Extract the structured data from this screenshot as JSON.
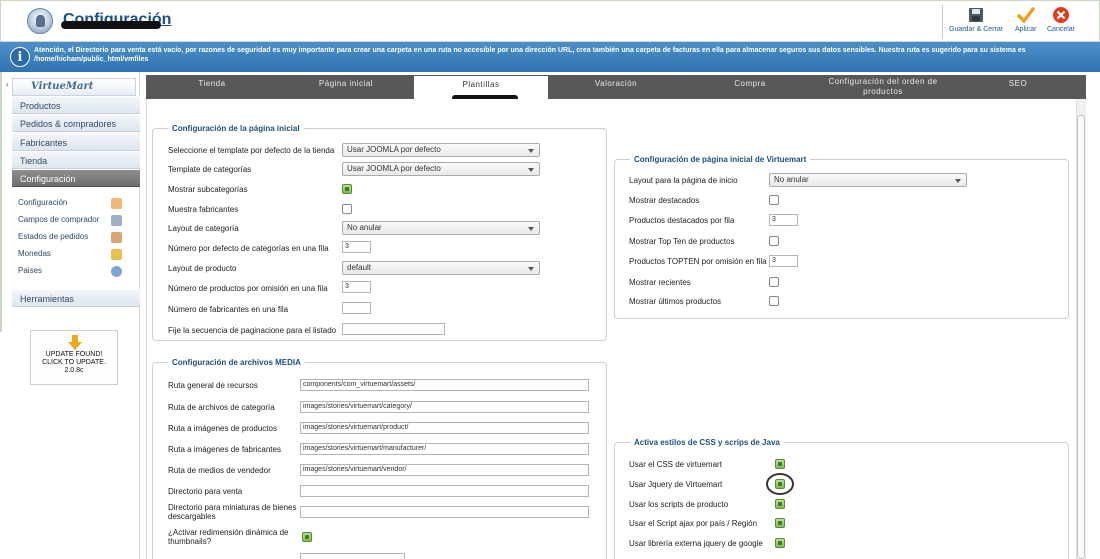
{
  "header": {
    "title": "Configuración",
    "buttons": [
      {
        "label": "Guardar & Cerrar",
        "icon": "save-icon"
      },
      {
        "label": "Aplicar",
        "icon": "checkmark-icon"
      },
      {
        "label": "Cancelar",
        "icon": "cancel-icon"
      }
    ]
  },
  "info_bar": {
    "message": "Atención, el Directorio para venta está vacío, por razones de seguridad es muy importante para crear una carpeta en una ruta no accesible por una dirección URL, crea también una carpeta de facturas en ella para almacenar seguros sus datos sensibles. Nuestra ruta es sugerido para su sistema es /home/hicham/public_html/vmfiles"
  },
  "sidebar": {
    "logo": "VirtueMart",
    "items": [
      {
        "label": "Productos"
      },
      {
        "label": "Pedidos & compradores"
      },
      {
        "label": "Fabricantes"
      },
      {
        "label": "Tienda"
      },
      {
        "label": "Configuración"
      }
    ],
    "sub_items": [
      {
        "label": "Configuración",
        "icon_color": "#e07a2a"
      },
      {
        "label": "Campos de comprador",
        "icon_color": "#7a8fa8"
      },
      {
        "label": "Estados de pedidos",
        "icon_color": "#c98a4a"
      },
      {
        "label": "Monedas",
        "icon_color": "#e0b040"
      },
      {
        "label": "Paises",
        "icon_color": "#5a8ab8"
      }
    ],
    "tools": "Herramientas",
    "update": {
      "line1": "UPDATE FOUND!",
      "line2": "CLICK TO UPDATE.",
      "version": "2.0.8c"
    }
  },
  "tabs": [
    {
      "label": "Tienda"
    },
    {
      "label": "Página inicial"
    },
    {
      "label": "Plantillas"
    },
    {
      "label": "Valoración"
    },
    {
      "label": "Compra"
    },
    {
      "label": "Configuración del orden de productos"
    },
    {
      "label": "SEO"
    }
  ],
  "inicio": {
    "legend": "Configuración de la página inicial",
    "rows": [
      {
        "label": "Seleccione el template por defecto de la tienda",
        "select": "Usar JOOMLA por defecto"
      },
      {
        "label": "Template de categorías",
        "select": "Usar JOOMLA por defecto"
      },
      {
        "label": "Mostrar subcategorías",
        "checked": true
      },
      {
        "label": "Muestra fabricantes",
        "checked": false
      },
      {
        "label": "Layout de categoría",
        "select": "No anular"
      },
      {
        "label": "Número por defecto de categorías en una fila",
        "input": "3"
      },
      {
        "label": "Layout de producto",
        "select": "default"
      },
      {
        "label": "Número de productos por omisión en una fila",
        "input": "3"
      },
      {
        "label": "Número de fabricantes en una fila",
        "input": ""
      },
      {
        "label": "Fije la secuencia de paginacione para el listado",
        "input": ""
      }
    ]
  },
  "media": {
    "legend": "Configuración de archivos MEDIA",
    "rows": [
      {
        "label": "Ruta general de recursos",
        "input": "components/com_virtuemart/assets/"
      },
      {
        "label": "Ruta de archivos de categoría",
        "input": "images/stories/virtuemart/category/"
      },
      {
        "label": "Ruta a imágenes de productos",
        "input": "images/stories/virtuemart/product/"
      },
      {
        "label": "Ruta a imágenes de fabricantes",
        "input": "images/stories/virtuemart/manufacturer/"
      },
      {
        "label": "Ruta de medios de vendedor",
        "input": "images/stories/virtuemart/vendor/"
      },
      {
        "label": "Directorio para venta",
        "input": ""
      },
      {
        "label": "Directorio para miniaturas de bienes descargables",
        "input": ""
      },
      {
        "label": "¿Activar redimensión dinámica de thumbnails?",
        "checked": true
      }
    ]
  },
  "vm_inicio": {
    "legend": "Configuración de página inicial de Virtuemart",
    "rows": [
      {
        "label": "Layout para la página de inicio",
        "select": "No anular"
      },
      {
        "label": "Mostrar destacados",
        "checked": false
      },
      {
        "label": "Productos destacados por fila",
        "input": "3"
      },
      {
        "label": "Mostrar Top Ten de productos",
        "checked": false
      },
      {
        "label": "Productos TOPTEN por omisión en fila",
        "input": "3"
      },
      {
        "label": "Mostrar recientes",
        "checked": false
      },
      {
        "label": "Mostrar últimos productos",
        "checked": false
      }
    ]
  },
  "css_js": {
    "legend": "Activa estilos de CSS y scrips de Java",
    "rows": [
      {
        "label": "Usar el CSS de virtuemart",
        "checked": true
      },
      {
        "label": "Usar Jquery de Virtuemart",
        "checked": true
      },
      {
        "label": "Usar los scripts de producto",
        "checked": true
      },
      {
        "label": "Usar el Script ajax por país / Región",
        "checked": true
      },
      {
        "label": "Usar librería externa jquery de google",
        "checked": true
      }
    ]
  },
  "colors": {
    "accent": "#1b4f8c",
    "info_bar": "#3b80bd",
    "tab_bar": "#585858",
    "check_on": "#7fbf52"
  }
}
